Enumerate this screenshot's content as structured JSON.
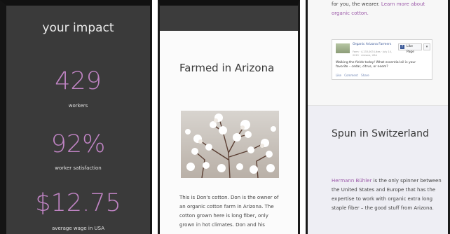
{
  "impact": {
    "title": "your impact",
    "stats": [
      {
        "value": "429",
        "label": "workers"
      },
      {
        "value": "92%",
        "label": "worker satisfaction"
      },
      {
        "value": "$12.75",
        "label": "average wage in USA"
      }
    ]
  },
  "arizona": {
    "heading": "Farmed in Arizona",
    "body": "This is Don's cotton. Don is the owner of an organic cotton farm in Arizona. The cotton grown here is long fiber, only grown in hot climates. Don and his"
  },
  "switzerland": {
    "lead_text": "for you, the wearer.",
    "lead_link": "Learn more about organic cotton.",
    "facebook": {
      "page_name": "Organic Arizona Farmers",
      "page_meta": "Farm · 4,133,003 Likes · July 14, 2015 · Arizona, USA",
      "like_label": "Like Page",
      "f_glyph": "f",
      "caret_glyph": "▾",
      "post_text": "Walking the fields today! What essential oil is your favorite – cedar, citrus, or neem?",
      "actions": [
        "Like",
        "Comment",
        "Share"
      ]
    },
    "heading": "Spun in Switzerland",
    "body_name": "Hermann Bühler",
    "body_text": " is the only spinner between the United States and Europe that has the expertise to work with organic extra long staple fiber – the good stuff from Arizona."
  },
  "colors": {
    "accent": "#c084c4",
    "link": "#9b59a8",
    "dark_bg": "#3a3a3a"
  }
}
